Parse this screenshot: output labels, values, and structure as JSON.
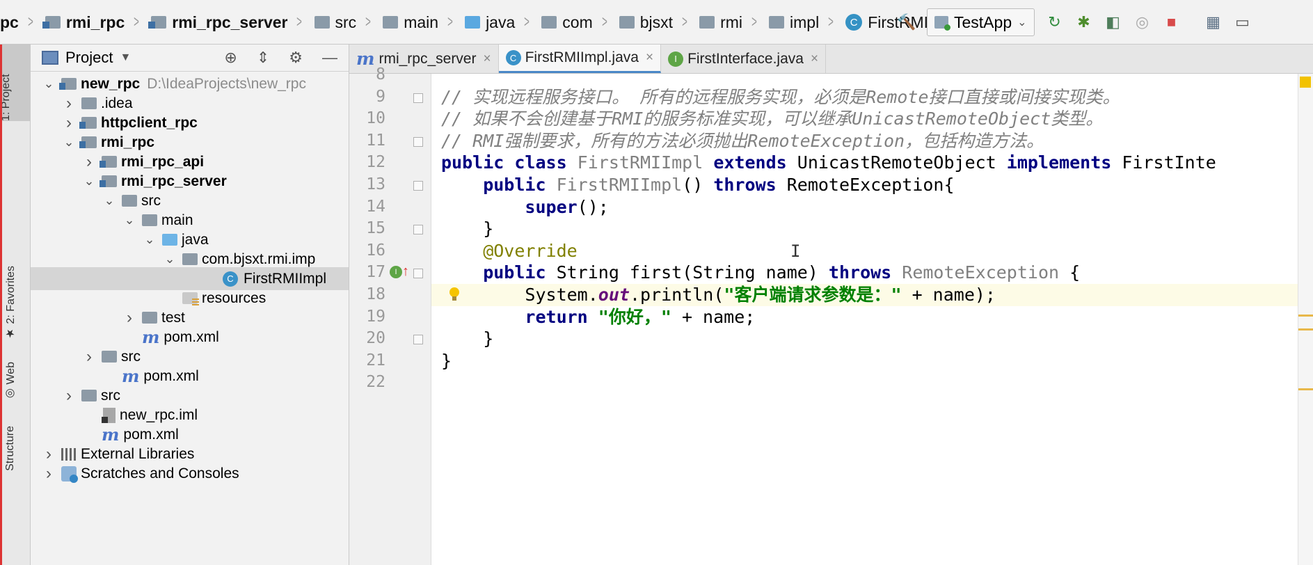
{
  "breadcrumbs": [
    {
      "label": "pc",
      "bold": true,
      "icon": "none"
    },
    {
      "label": "rmi_rpc",
      "bold": true,
      "icon": "module"
    },
    {
      "label": "rmi_rpc_server",
      "bold": true,
      "icon": "module"
    },
    {
      "label": "src",
      "bold": false,
      "icon": "folder"
    },
    {
      "label": "main",
      "bold": false,
      "icon": "folder"
    },
    {
      "label": "java",
      "bold": false,
      "icon": "folder-blue"
    },
    {
      "label": "com",
      "bold": false,
      "icon": "package"
    },
    {
      "label": "bjsxt",
      "bold": false,
      "icon": "package"
    },
    {
      "label": "rmi",
      "bold": false,
      "icon": "package"
    },
    {
      "label": "impl",
      "bold": false,
      "icon": "package"
    },
    {
      "label": "FirstRMIImpl",
      "bold": false,
      "icon": "class"
    }
  ],
  "run_config": {
    "label": "TestApp"
  },
  "toolbar_icons": [
    "hammer-icon",
    "rerun-icon",
    "debug-icon",
    "coverage-icon",
    "profile-icon",
    "stop-icon",
    "project-structure-icon",
    "terminal-icon"
  ],
  "side_tabs": {
    "project": "1: Project",
    "favorites": "2: Favorites",
    "web": "Web",
    "structure": "Structure"
  },
  "project_panel": {
    "title": "Project"
  },
  "tree": [
    {
      "label": "new_rpc",
      "extra": "D:\\IdeaProjects\\new_rpc",
      "level": 0,
      "arrow": "down",
      "icon": "module",
      "bold": true
    },
    {
      "label": ".idea",
      "level": 1,
      "arrow": "right",
      "icon": "folder",
      "bold": false
    },
    {
      "label": "httpclient_rpc",
      "level": 1,
      "arrow": "right",
      "icon": "module",
      "bold": true
    },
    {
      "label": "rmi_rpc",
      "level": 1,
      "arrow": "down",
      "icon": "module",
      "bold": true
    },
    {
      "label": "rmi_rpc_api",
      "level": 2,
      "arrow": "right",
      "icon": "module",
      "bold": true
    },
    {
      "label": "rmi_rpc_server",
      "level": 2,
      "arrow": "down",
      "icon": "module",
      "bold": true
    },
    {
      "label": "src",
      "level": 3,
      "arrow": "down",
      "icon": "folder",
      "bold": false
    },
    {
      "label": "main",
      "level": 4,
      "arrow": "down",
      "icon": "folder",
      "bold": false
    },
    {
      "label": "java",
      "level": 5,
      "arrow": "down",
      "icon": "folder-blue",
      "bold": false
    },
    {
      "label": "com.bjsxt.rmi.imp",
      "level": 6,
      "arrow": "down",
      "icon": "package",
      "bold": false
    },
    {
      "label": "FirstRMIImpl",
      "level": 8,
      "arrow": "none",
      "icon": "class",
      "bold": false,
      "selected": true
    },
    {
      "label": "resources",
      "level": 6,
      "arrow": "none",
      "icon": "resources",
      "bold": false
    },
    {
      "label": "test",
      "level": 4,
      "arrow": "right",
      "icon": "folder",
      "bold": false
    },
    {
      "label": "pom.xml",
      "level": 4,
      "arrow": "none",
      "icon": "maven",
      "bold": false
    },
    {
      "label": "src",
      "level": 2,
      "arrow": "right",
      "icon": "folder",
      "bold": false
    },
    {
      "label": "pom.xml",
      "level": 3,
      "arrow": "none",
      "icon": "maven",
      "bold": false
    },
    {
      "label": "src",
      "level": 1,
      "arrow": "right",
      "icon": "folder",
      "bold": false
    },
    {
      "label": "new_rpc.iml",
      "level": 2,
      "arrow": "none",
      "icon": "iml",
      "bold": false
    },
    {
      "label": "pom.xml",
      "level": 2,
      "arrow": "none",
      "icon": "maven",
      "bold": false
    },
    {
      "label": "External Libraries",
      "level": 0,
      "arrow": "right",
      "icon": "library",
      "bold": false
    },
    {
      "label": "Scratches and Consoles",
      "level": 0,
      "arrow": "right",
      "icon": "scratch",
      "bold": false
    }
  ],
  "editor_tabs": [
    {
      "label": "rmi_rpc_server",
      "icon": "maven",
      "active": false
    },
    {
      "label": "FirstRMIImpl.java",
      "icon": "class",
      "active": true
    },
    {
      "label": "FirstInterface.java",
      "icon": "interface",
      "active": false
    }
  ],
  "code_lines": [
    {
      "n": "8",
      "parts": []
    },
    {
      "n": "9",
      "parts": [
        {
          "t": "// 实现远程服务接口。 所有的远程服务实现，必须是Remote接口直接或间接实现类。",
          "c": "cm"
        }
      ]
    },
    {
      "n": "10",
      "parts": [
        {
          "t": "// 如果不会创建基于RMI的服务标准实现，可以继承UnicastRemoteObject类型。",
          "c": "cm"
        }
      ]
    },
    {
      "n": "11",
      "parts": [
        {
          "t": "// RMI强制要求，所有的方法必须抛出RemoteException，包括构造方法。",
          "c": "cm"
        }
      ]
    },
    {
      "n": "12",
      "parts": [
        {
          "t": "public class ",
          "c": "kw"
        },
        {
          "t": "FirstRMIImpl ",
          "c": "gr"
        },
        {
          "t": "extends ",
          "c": "kw"
        },
        {
          "t": "UnicastRemoteObject ",
          "c": ""
        },
        {
          "t": "implements ",
          "c": "kw"
        },
        {
          "t": "FirstInte",
          "c": ""
        }
      ]
    },
    {
      "n": "13",
      "parts": [
        {
          "t": "    public ",
          "c": "kw"
        },
        {
          "t": "FirstRMIImpl",
          "c": "gr"
        },
        {
          "t": "() ",
          "c": ""
        },
        {
          "t": "throws ",
          "c": "kw"
        },
        {
          "t": "RemoteException{",
          "c": ""
        }
      ]
    },
    {
      "n": "14",
      "parts": [
        {
          "t": "        super",
          "c": "kw"
        },
        {
          "t": "();",
          "c": ""
        }
      ]
    },
    {
      "n": "15",
      "parts": [
        {
          "t": "    }",
          "c": ""
        }
      ]
    },
    {
      "n": "16",
      "parts": [
        {
          "t": "    @Override",
          "c": "an"
        }
      ]
    },
    {
      "n": "17",
      "parts": [
        {
          "t": "    public ",
          "c": "kw"
        },
        {
          "t": "String first(String name) ",
          "c": ""
        },
        {
          "t": "throws ",
          "c": "kw"
        },
        {
          "t": "RemoteException",
          "c": "gr"
        },
        {
          "t": " {",
          "c": ""
        }
      ]
    },
    {
      "n": "18",
      "parts": [
        {
          "t": "        System.",
          "c": ""
        },
        {
          "t": "out",
          "c": "fld"
        },
        {
          "t": ".println(",
          "c": ""
        },
        {
          "t": "\"客户端请求参数是：\"",
          "c": "st"
        },
        {
          "t": " + name);",
          "c": ""
        }
      ]
    },
    {
      "n": "19",
      "parts": [
        {
          "t": "        return ",
          "c": "kw"
        },
        {
          "t": "\"你好，\"",
          "c": "st"
        },
        {
          "t": " + name;",
          "c": ""
        }
      ]
    },
    {
      "n": "20",
      "parts": [
        {
          "t": "    }",
          "c": ""
        }
      ]
    },
    {
      "n": "21",
      "parts": [
        {
          "t": "}",
          "c": ""
        }
      ]
    },
    {
      "n": "22",
      "parts": []
    }
  ]
}
